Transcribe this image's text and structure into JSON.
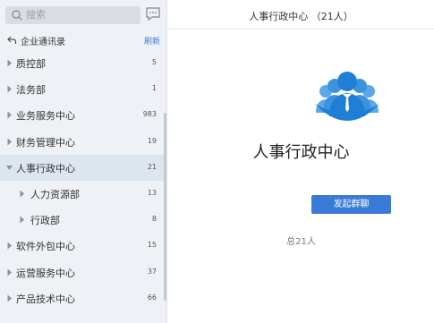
{
  "search": {
    "placeholder": "搜索"
  },
  "header": {
    "title": "企业通讯录",
    "refresh": "刷新"
  },
  "departments": [
    {
      "label": "质控部",
      "count": "5",
      "level": 0,
      "expanded": false
    },
    {
      "label": "法务部",
      "count": "1",
      "level": 0,
      "expanded": false
    },
    {
      "label": "业务服务中心",
      "count": "983",
      "level": 0,
      "expanded": false
    },
    {
      "label": "财务管理中心",
      "count": "19",
      "level": 0,
      "expanded": false
    },
    {
      "label": "人事行政中心",
      "count": "21",
      "level": 0,
      "expanded": true,
      "selected": true
    },
    {
      "label": "人力资源部",
      "count": "13",
      "level": 1,
      "expanded": false
    },
    {
      "label": "行政部",
      "count": "8",
      "level": 1,
      "expanded": false
    },
    {
      "label": "软件外包中心",
      "count": "15",
      "level": 0,
      "expanded": false
    },
    {
      "label": "运营服务中心",
      "count": "37",
      "level": 0,
      "expanded": false
    },
    {
      "label": "产品技术中心",
      "count": "66",
      "level": 0,
      "expanded": false
    }
  ],
  "main": {
    "title": "人事行政中心 （21人）",
    "group_name": "人事行政中心",
    "start_chat": "发起群聊",
    "total": "总21人"
  },
  "colors": {
    "accent": "#3a7bd5",
    "sidebar_bg": "#eef1f5",
    "selected_bg": "#dde5ef"
  },
  "icons": [
    "search-icon",
    "chat-icon",
    "back-arrow-icon",
    "caret-right-icon",
    "caret-down-icon",
    "group-avatar-icon"
  ]
}
